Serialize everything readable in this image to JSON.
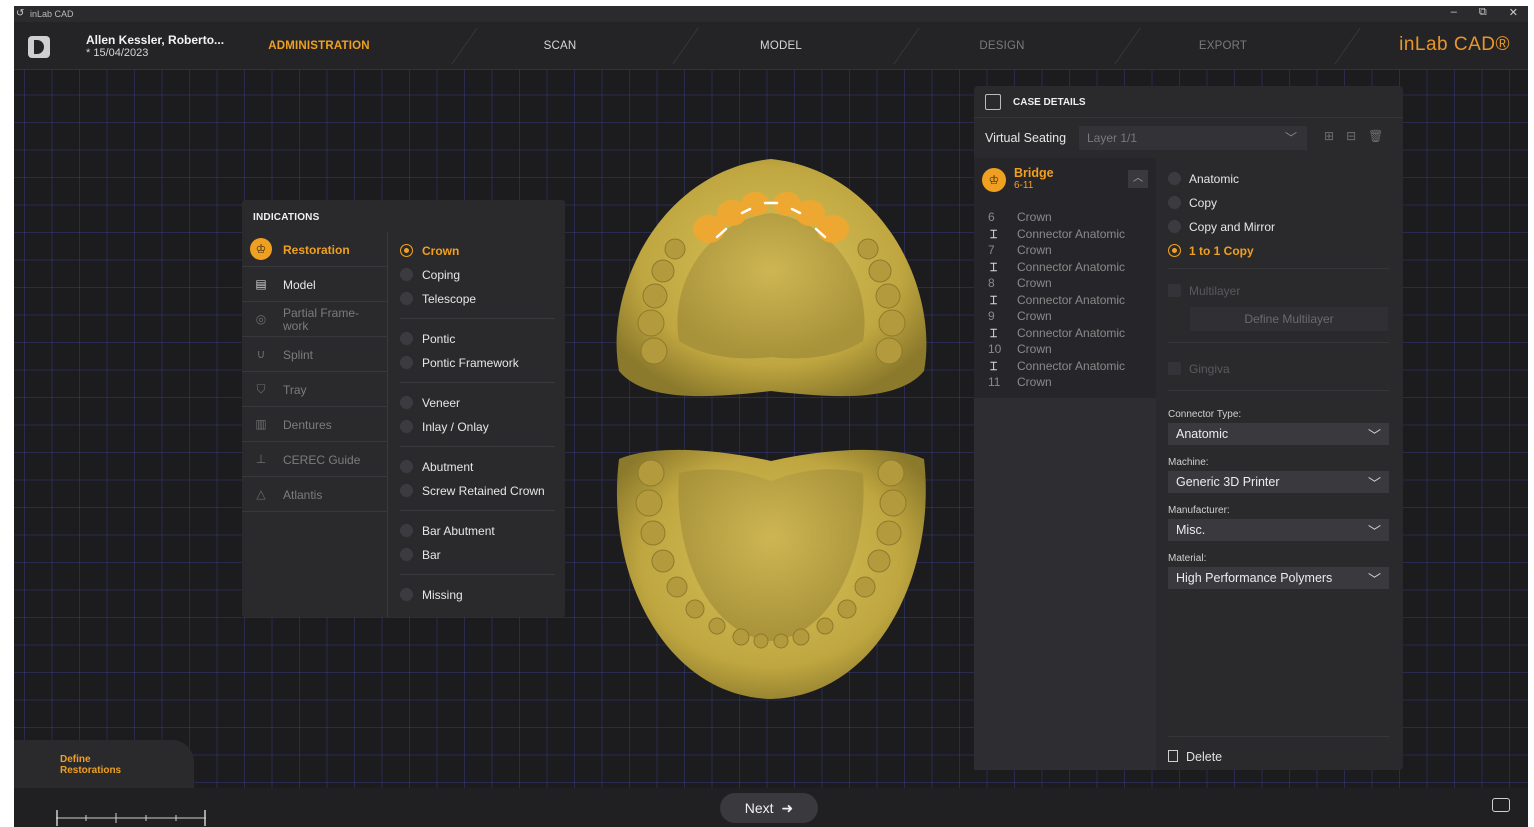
{
  "window": {
    "title": "inLab CAD",
    "controls": [
      "–",
      "⧉",
      "✕"
    ]
  },
  "header": {
    "patient_name": "Allen Kessler, Roberto...",
    "patient_date": "* 15/04/2023",
    "steps": [
      {
        "label": "ADMINISTRATION",
        "state": "active"
      },
      {
        "label": "SCAN",
        "state": "normal"
      },
      {
        "label": "MODEL",
        "state": "normal"
      },
      {
        "label": "DESIGN",
        "state": "disabled"
      },
      {
        "label": "EXPORT",
        "state": "disabled"
      }
    ],
    "brand": "inLab CAD®"
  },
  "indications": {
    "title": "INDICATIONS",
    "categories": [
      {
        "label": "Restoration",
        "icon": "tooth-icon",
        "state": "active"
      },
      {
        "label": "Model",
        "icon": "model-icon",
        "state": "normal"
      },
      {
        "label": "Partial Frame-work",
        "icon": "framework-icon",
        "state": "disabled"
      },
      {
        "label": "Splint",
        "icon": "splint-icon",
        "state": "disabled"
      },
      {
        "label": "Tray",
        "icon": "tray-icon",
        "state": "disabled"
      },
      {
        "label": "Dentures",
        "icon": "dentures-icon",
        "state": "disabled"
      },
      {
        "label": "CEREC Guide",
        "icon": "guide-icon",
        "state": "disabled"
      },
      {
        "label": "Atlantis",
        "icon": "atlantis-icon",
        "state": "disabled"
      }
    ],
    "types": [
      {
        "label": "Crown",
        "selected": true
      },
      {
        "label": "Coping",
        "selected": false
      },
      {
        "label": "Telescope",
        "selected": false
      },
      {
        "label": "Pontic",
        "selected": false
      },
      {
        "label": "Pontic Framework",
        "selected": false
      },
      {
        "label": "Veneer",
        "selected": false
      },
      {
        "label": "Inlay / Onlay",
        "selected": false
      },
      {
        "label": "Abutment",
        "selected": false
      },
      {
        "label": "Screw Retained Crown",
        "selected": false
      },
      {
        "label": "Bar Abutment",
        "selected": false
      },
      {
        "label": "Bar",
        "selected": false
      },
      {
        "label": "Missing",
        "selected": false
      }
    ]
  },
  "case_details": {
    "title": "CASE DETAILS",
    "virtual_seating_label": "Virtual Seating",
    "layer_value": "Layer 1/1",
    "bridge": {
      "name": "Bridge",
      "range": "6-11",
      "rows": [
        {
          "num": "6",
          "label": "Crown"
        },
        {
          "num": "",
          "label": "Connector Anatomic"
        },
        {
          "num": "7",
          "label": "Crown"
        },
        {
          "num": "",
          "label": "Connector Anatomic"
        },
        {
          "num": "8",
          "label": "Crown"
        },
        {
          "num": "",
          "label": "Connector Anatomic"
        },
        {
          "num": "9",
          "label": "Crown"
        },
        {
          "num": "",
          "label": "Connector Anatomic"
        },
        {
          "num": "10",
          "label": "Crown"
        },
        {
          "num": "",
          "label": "Connector Anatomic"
        },
        {
          "num": "11",
          "label": "Crown"
        }
      ]
    },
    "design_options": [
      {
        "label": "Anatomic",
        "selected": false
      },
      {
        "label": "Copy",
        "selected": false
      },
      {
        "label": "Copy and Mirror",
        "selected": false
      },
      {
        "label": "1 to 1 Copy",
        "selected": true
      }
    ],
    "multilayer_label": "Multilayer",
    "define_multilayer_label": "Define Multilayer",
    "gingiva_label": "Gingiva",
    "connector_type": {
      "label": "Connector Type:",
      "value": "Anatomic"
    },
    "machine": {
      "label": "Machine:",
      "value": "Generic 3D Printer"
    },
    "manufacturer": {
      "label": "Manufacturer:",
      "value": "Misc."
    },
    "material": {
      "label": "Material:",
      "value": "High Performance Polymers"
    },
    "delete_label": "Delete"
  },
  "footer": {
    "define_restorations": "Define Restorations",
    "next_label": "Next"
  },
  "colors": {
    "accent": "#f0a020",
    "model": "#c9b14a",
    "background": "#1c1c1e",
    "panel": "#2a2a2d"
  }
}
